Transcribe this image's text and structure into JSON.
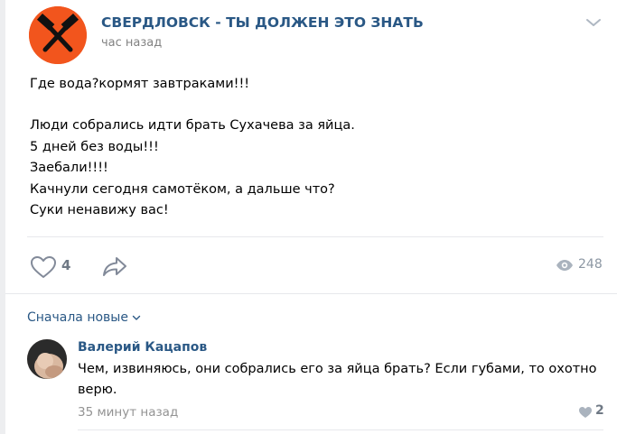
{
  "post": {
    "group_name": "СВЕРДЛОВСК - ТЫ ДОЛЖЕН ЭТО ЗНАТЬ",
    "time": "час назад",
    "lines": [
      "Где вода?кормят завтраками!!!",
      "",
      "Люди собрались идти брать Сухачева за яйца.",
      "5 дней без воды!!!",
      "Заебали!!!!",
      "Качнули сегодня самотёком, а дальше что?",
      "Суки ненавижу вас!"
    ],
    "likes": "4",
    "views": "248"
  },
  "comments_sort": "Сначала новые",
  "comment": {
    "author": "Валерий Кацапов",
    "lines": [
      "Чем, извиняюсь, они собрались его за яйца брать? Если губами, то охотно",
      "верю."
    ],
    "time": "35 минут назад",
    "likes": "2"
  },
  "colors": {
    "link": "#2a5885",
    "avatar_bg": "#f2551d",
    "page_bg": "#edeef0"
  },
  "icons": [
    "hammers-logo-icon",
    "chevron-down-icon",
    "heart-icon",
    "share-arrow-icon",
    "eye-icon"
  ]
}
